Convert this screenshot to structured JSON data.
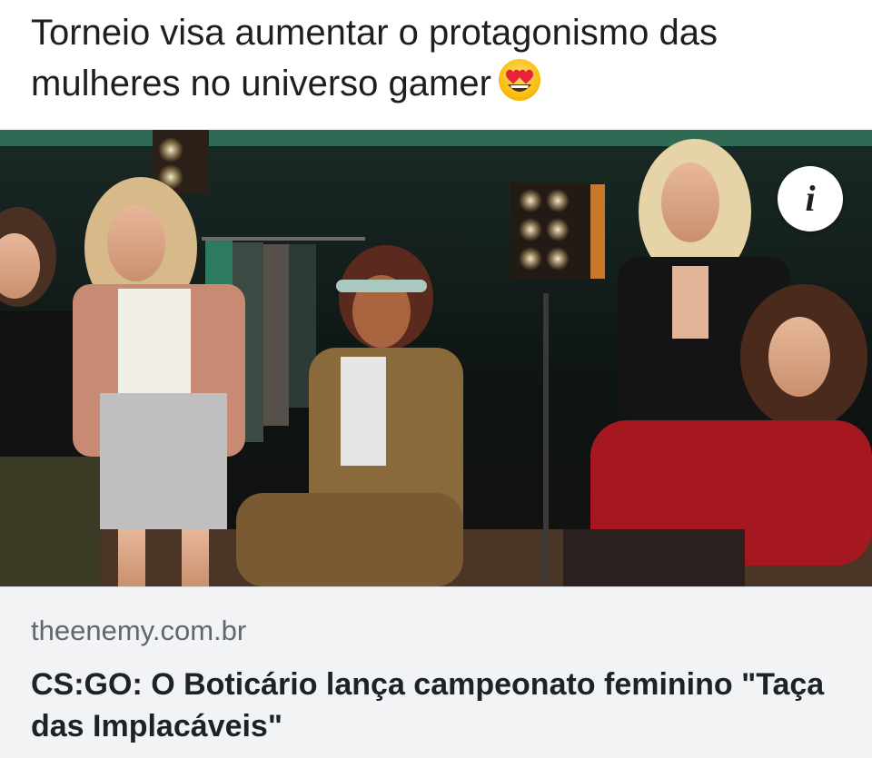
{
  "post": {
    "text": "Torneio visa  aumentar o protagonismo das mulheres no universo gamer",
    "emoji": "smiling-face-with-heart-eyes"
  },
  "photo": {
    "info_label": "i"
  },
  "link_preview": {
    "domain": "theenemy.com.br",
    "title": "CS:GO: O Boticário lança campeonato feminino \"Taça das Implacáveis\""
  },
  "colors": {
    "text": "#1c1e21",
    "domain": "#606770",
    "card_bg": "#f2f3f5"
  }
}
